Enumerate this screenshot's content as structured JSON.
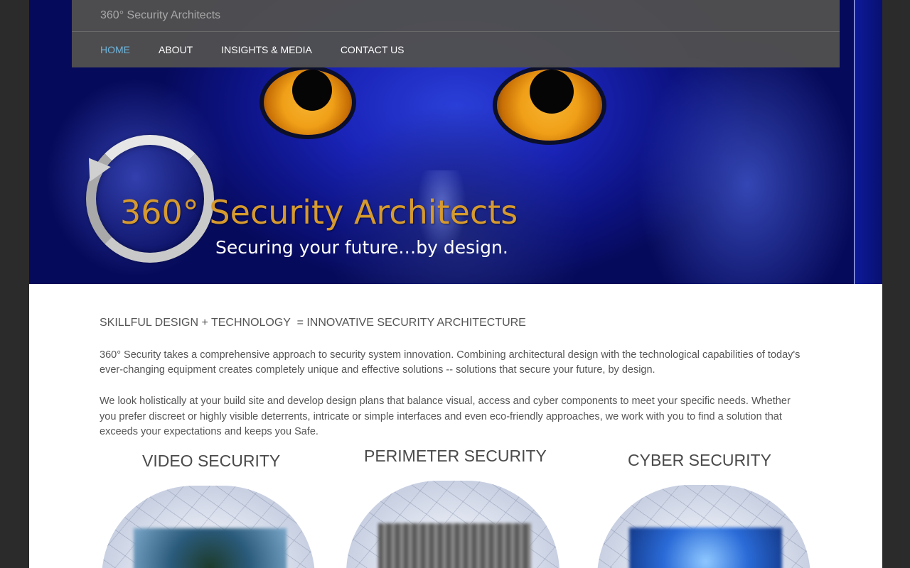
{
  "site": {
    "title": "360° Security Architects"
  },
  "nav": {
    "items": [
      {
        "label": "HOME",
        "active": true
      },
      {
        "label": "ABOUT",
        "active": false
      },
      {
        "label": "INSIGHTS & MEDIA",
        "active": false
      },
      {
        "label": "CONTACT US",
        "active": false
      }
    ]
  },
  "hero": {
    "logo_title": "360° Security Architects",
    "tagline": "Securing your future…by design.",
    "accent_color": "#d69a2e"
  },
  "content": {
    "headline": "SKILLFUL DESIGN + TECHNOLOGY  = INNOVATIVE SECURITY ARCHITECTURE",
    "paragraph1": "360° Security takes a comprehensive approach to security system innovation.  Combining architectural design with the technological capabilities of today's ever-changing equipment creates completely unique and effective solutions -- solutions that secure your future, by design.",
    "paragraph2": "We look holistically at your build site and develop design plans that balance visual, access and cyber components to meet your specific needs.  Whether you prefer discreet or highly visible deterrents, intricate or simple interfaces and even eco-friendly approaches, we work with you to find a solution that exceeds your expectations and keeps you Safe."
  },
  "services": [
    {
      "title": "VIDEO SECURITY"
    },
    {
      "title": "PERIMETER SECURITY"
    },
    {
      "title": "CYBER SECURITY"
    }
  ],
  "colors": {
    "nav_active": "#6fb3d9",
    "header_bg": "#505050",
    "text": "#555555"
  }
}
